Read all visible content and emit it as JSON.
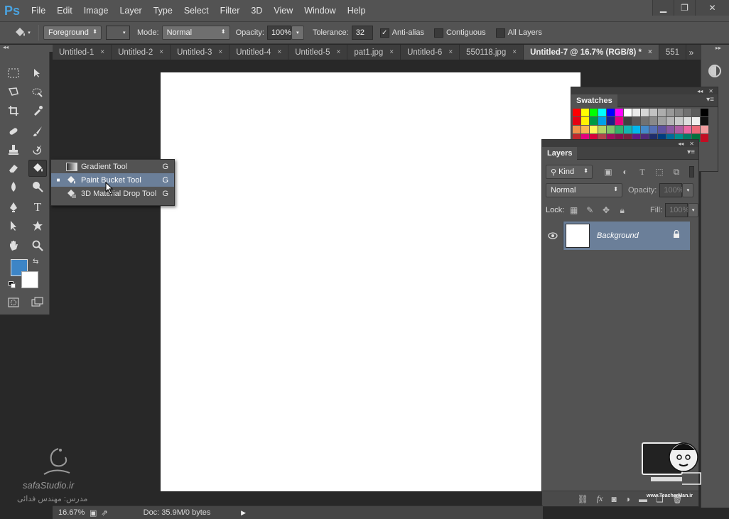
{
  "app": {
    "logo": "Ps"
  },
  "menu": [
    "File",
    "Edit",
    "Image",
    "Layer",
    "Type",
    "Select",
    "Filter",
    "3D",
    "View",
    "Window",
    "Help"
  ],
  "window_controls": {
    "minimize": "▁",
    "restore": "❐",
    "close": "✕"
  },
  "options_bar": {
    "fill_source": "Foreground",
    "mode_label": "Mode:",
    "mode_value": "Normal",
    "opacity_label": "Opacity:",
    "opacity_value": "100%",
    "tolerance_label": "Tolerance:",
    "tolerance_value": "32",
    "anti_alias_label": "Anti-alias",
    "anti_alias_checked": true,
    "contiguous_label": "Contiguous",
    "contiguous_checked": false,
    "all_layers_label": "All Layers",
    "all_layers_checked": false
  },
  "tabs": [
    {
      "label": "Untitled-1"
    },
    {
      "label": "Untitled-2"
    },
    {
      "label": "Untitled-3"
    },
    {
      "label": "Untitled-4"
    },
    {
      "label": "Untitled-5"
    },
    {
      "label": "pat1.jpg"
    },
    {
      "label": "Untitled-6"
    },
    {
      "label": "550118.jpg"
    },
    {
      "label": "Untitled-7 @ 16.7% (RGB/8) *",
      "active": true
    },
    {
      "label": "551"
    }
  ],
  "tab_overflow": "»",
  "tab_close": "×",
  "flyout": {
    "items": [
      {
        "label": "Gradient Tool",
        "shortcut": "G"
      },
      {
        "label": "Paint Bucket Tool",
        "shortcut": "G",
        "selected": true,
        "bullet": "■"
      },
      {
        "label": "3D Material Drop Tool",
        "shortcut": "G"
      }
    ]
  },
  "colors": {
    "foreground": "#3d85c6",
    "background": "#ffffff",
    "selection": "#6b7f99",
    "ui_panel": "#535353"
  },
  "swatches_panel": {
    "title": "Swatches",
    "collapse": "◂◂",
    "close": "✕",
    "menu": "▾≡"
  },
  "layers_panel": {
    "title": "Layers",
    "collapse": "◂◂",
    "close": "✕",
    "menu": "▾≡",
    "filter_kind": "Kind",
    "blend_mode": "Normal",
    "opacity_label": "Opacity:",
    "opacity_value": "100%",
    "lock_label": "Lock:",
    "fill_label": "Fill:",
    "fill_value": "100%",
    "layers": [
      {
        "name": "Background",
        "locked": true
      }
    ]
  },
  "status": {
    "zoom": "16.67%",
    "doc": "Doc: 35.9M/0 bytes",
    "arrow": "▶"
  },
  "watermark_left": {
    "site": "safaStudio.ir",
    "teacher": "مدرس: مهندس فدائی"
  },
  "watermark_right": {
    "site": "www.TeacherMan.ir"
  }
}
